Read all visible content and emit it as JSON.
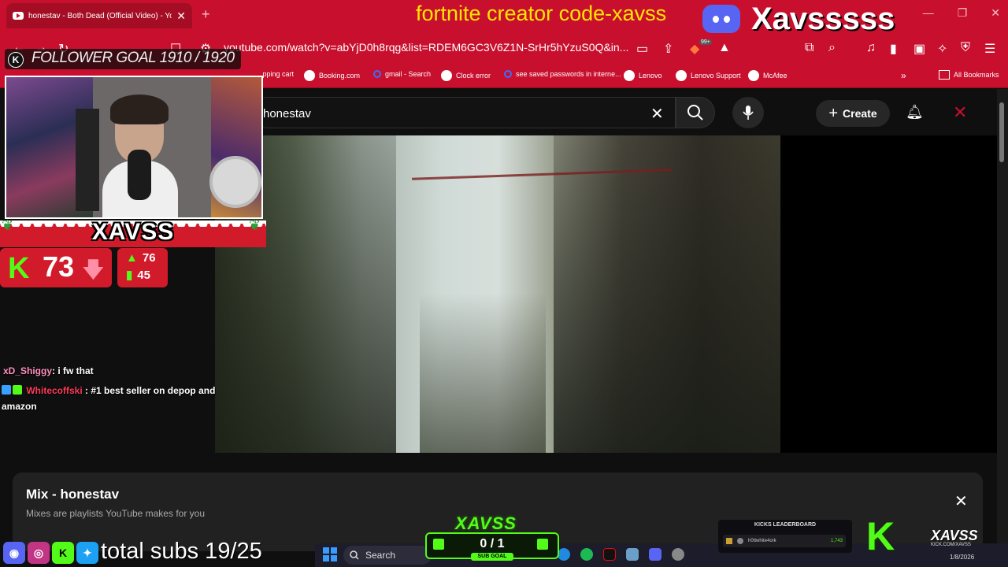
{
  "browser": {
    "tab_title": "honestav - Both Dead (Official Video) - YouTube",
    "new_tab": "+",
    "url": "youtube.com/watch?v=abYjD0h8rqg&list=RDEM6GC3V6Z1N-SrHr5hYzuS0Q&in...",
    "bookmarks": [
      {
        "label": "...pping cart"
      },
      {
        "label": "Booking.com"
      },
      {
        "label": "gmail - Search"
      },
      {
        "label": "Clock error"
      },
      {
        "label": "see saved passwords in interne..."
      },
      {
        "label": "Lenovo"
      },
      {
        "label": "Lenovo Support"
      },
      {
        "label": "McAfee"
      }
    ],
    "all_bookmarks": "All Bookmarks",
    "ext_badge": "99+"
  },
  "youtube": {
    "search_value": "honestav",
    "create_label": "Create",
    "mix_title": "Mix - honestav",
    "mix_subtitle": "Mixes are playlists YouTube makes for you"
  },
  "overlay": {
    "follower_goal": "FOLLOWER GOAL 1910 / 1920",
    "streamer_name": "XAVSS",
    "viewers": "73",
    "followers_up": "76",
    "followers_total": "45",
    "creator_code": "fortnite creator code-xavss",
    "discord_name": "Xavsssss",
    "total_subs": "total subs 19/25",
    "sub_goal_logo": "XAVSS",
    "sub_goal_count": "0 / 1",
    "sub_goal_label": "SUB GOAL",
    "leaderboard_title": "KICKS LEADERBOARD",
    "leaderboard_user": "h0ttwhite4ork",
    "leaderboard_value": "1,743",
    "kick_name": "XAVSS",
    "kick_url": "KICK.COM/XAVSS"
  },
  "chat": [
    {
      "user": "xD_Shiggy",
      "message": ": i fw that"
    },
    {
      "user": "Whitecoffski",
      "message": ": #1 best seller on depop and amazon"
    }
  ],
  "taskbar": {
    "search_label": "Search",
    "date": "1/8/2026"
  },
  "colors": {
    "browser_red": "#c8102e",
    "kick_green": "#53fc18",
    "creator_code_yellow": "#ffe600",
    "discord_blurple": "#5865f2"
  }
}
